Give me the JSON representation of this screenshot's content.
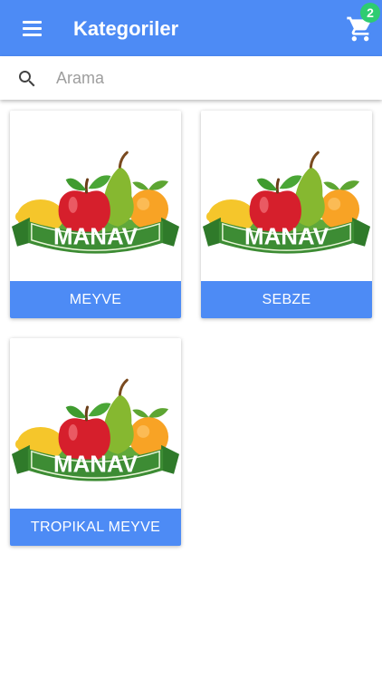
{
  "header": {
    "title": "Kategoriler",
    "cart_count": "2"
  },
  "search": {
    "placeholder": "Arama",
    "value": ""
  },
  "categories": [
    {
      "label": "MEYVE",
      "logo_text": "MANAV"
    },
    {
      "label": "SEBZE",
      "logo_text": "MANAV"
    },
    {
      "label": "TROPIKAL MEYVE",
      "logo_text": "MANAV"
    }
  ],
  "colors": {
    "primary": "#4d8bf5",
    "badge": "#2ecc71"
  },
  "icons": {
    "menu": "menu-icon",
    "cart": "cart-icon",
    "search": "search-icon"
  }
}
